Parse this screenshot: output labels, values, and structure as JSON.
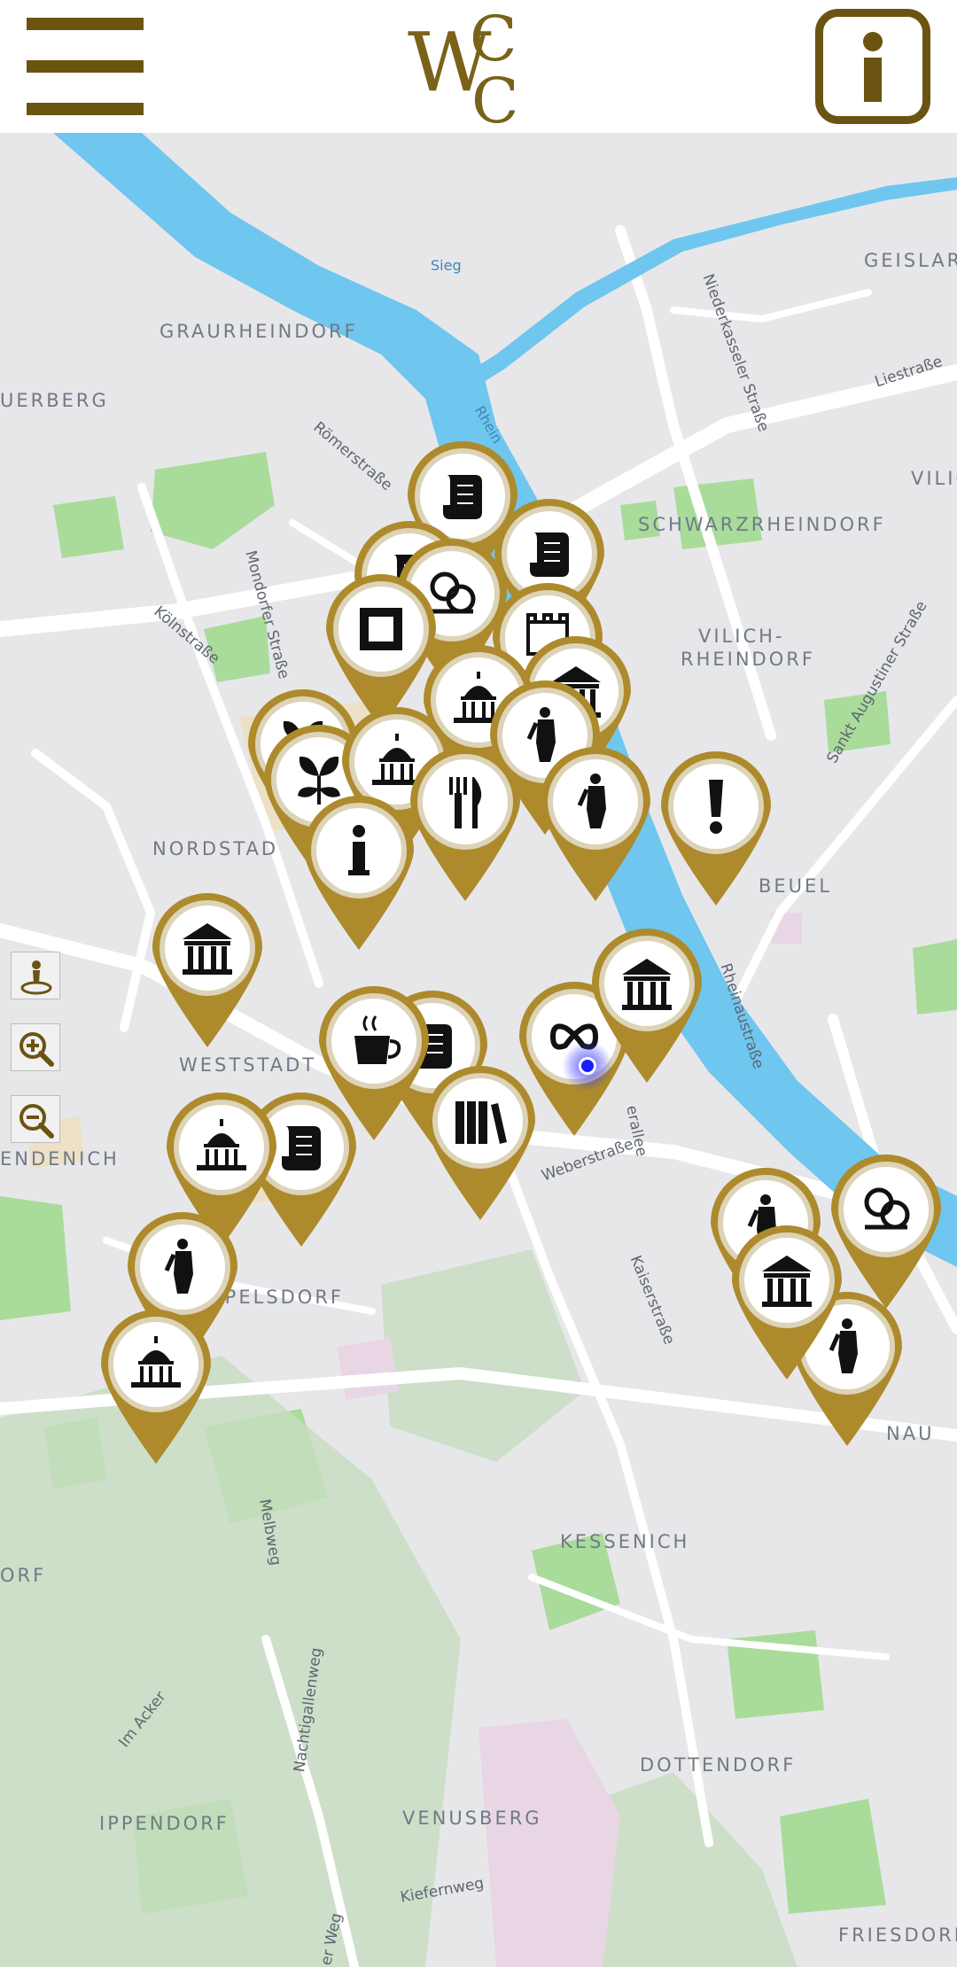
{
  "header": {
    "menu_icon": "hamburger-menu-icon",
    "logo": "WCC",
    "info_icon": "info-icon",
    "brand_color": "#6b5412"
  },
  "map": {
    "places": [
      {
        "id": "geislar",
        "name": "GEISLAR"
      },
      {
        "id": "graurheindorf",
        "name": "GRAURHEINDORF"
      },
      {
        "id": "auerberg",
        "name": "UERBERG"
      },
      {
        "id": "vilich",
        "name": "VILIC"
      },
      {
        "id": "schwarzrheindorf",
        "name": "SCHWARZRHEINDORF"
      },
      {
        "id": "vilich-rheindorf-1",
        "name": "VILICH-"
      },
      {
        "id": "vilich-rheindorf-2",
        "name": "RHEINDORF"
      },
      {
        "id": "nordstadt",
        "name": "NORDSTAD"
      },
      {
        "id": "beuel",
        "name": "BEUEL"
      },
      {
        "id": "weststadt",
        "name": "WESTSTADT"
      },
      {
        "id": "endenich",
        "name": "ENDENICH"
      },
      {
        "id": "poppelsdorf",
        "name": "PPELSDORF"
      },
      {
        "id": "kessenich",
        "name": "KESSENICH"
      },
      {
        "id": "dottendorf",
        "name": "DOTTENDORF"
      },
      {
        "id": "ippendorf",
        "name": "IPPENDORF"
      },
      {
        "id": "venusberg",
        "name": "VENUSBERG"
      },
      {
        "id": "friesdorf",
        "name": "FRIESDORF"
      },
      {
        "id": "orf",
        "name": "ORF"
      },
      {
        "id": "nau",
        "name": "NAU"
      }
    ],
    "streets": [
      {
        "id": "niederkasseler",
        "name": "Niederkasseler Straße"
      },
      {
        "id": "liestrasse",
        "name": "Liestraße"
      },
      {
        "id": "roemerstrasse",
        "name": "Römerstraße"
      },
      {
        "id": "koelnstrasse",
        "name": "Kölnstraße"
      },
      {
        "id": "mondorfer",
        "name": "Mondorfer Straße"
      },
      {
        "id": "sankt-augustiner",
        "name": "Sankt Augustiner Straße"
      },
      {
        "id": "rheinaustrasse",
        "name": "Rheinaustraße"
      },
      {
        "id": "weberstrasse",
        "name": "Weberstraße"
      },
      {
        "id": "kaiserstrasse",
        "name": "Kaiserstraße"
      },
      {
        "id": "meliweg",
        "name": "Melbweg"
      },
      {
        "id": "im-acker",
        "name": "Im Acker"
      },
      {
        "id": "nachtigallenweg",
        "name": "Nachtigallenweg"
      },
      {
        "id": "kiefernweg",
        "name": "Kiefernweg"
      },
      {
        "id": "weg",
        "name": "er Weg"
      },
      {
        "id": "allee",
        "name": "erallee"
      }
    ],
    "river_labels": [
      "Rhein",
      "Sieg"
    ],
    "marker_icons": [
      "scroll-icon",
      "puzzle-icon",
      "picture-frame-icon",
      "museum-icon",
      "leaf-icon",
      "fork-knife-icon",
      "info-icon",
      "statue-icon",
      "exclamation-icon",
      "coffee-icon",
      "books-icon",
      "infinity-icon",
      "capitol-dome-icon",
      "castle-icon"
    ],
    "colors": {
      "land": "#e7e7ea",
      "water": "#6fc6ef",
      "park": "#a8dc9a",
      "road": "#ffffff",
      "marker_gold": "#ad8a2b",
      "location_dot": "#1b1bff"
    }
  },
  "controls": {
    "locate_icon": "locate-person-icon",
    "zoom_in_icon": "zoom-in-icon",
    "zoom_out_icon": "zoom-out-icon"
  }
}
